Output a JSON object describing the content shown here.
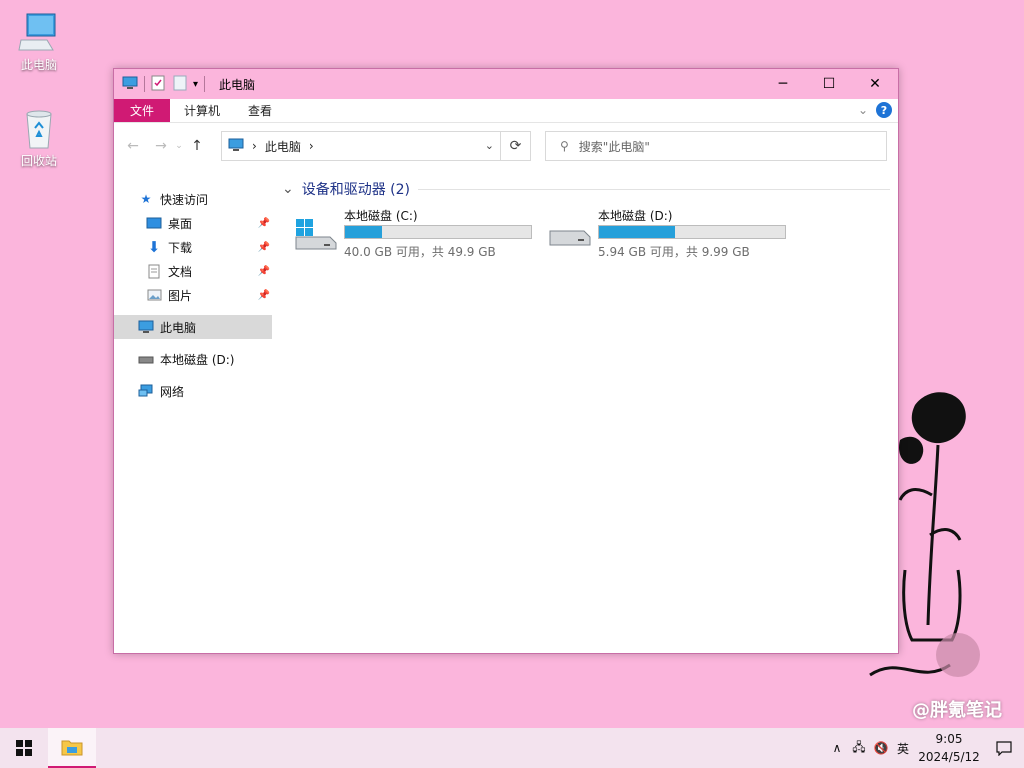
{
  "desktop": {
    "icons": [
      {
        "label": "此电脑",
        "icon": "computer-icon"
      },
      {
        "label": "回收站",
        "icon": "recycle-bin-icon"
      }
    ]
  },
  "window": {
    "title": "此电脑",
    "ribbon": {
      "tabs": [
        "文件",
        "计算机",
        "查看"
      ],
      "help": "?"
    },
    "nav": {
      "address_location": "此电脑",
      "search_placeholder": "搜索\"此电脑\""
    },
    "sidebar": {
      "quick_access": "快速访问",
      "quick_items": [
        {
          "label": "桌面",
          "icon": "desktop-icon"
        },
        {
          "label": "下载",
          "icon": "download-icon"
        },
        {
          "label": "文档",
          "icon": "documents-icon"
        },
        {
          "label": "图片",
          "icon": "pictures-icon"
        }
      ],
      "this_pc": "此电脑",
      "drive_d": "本地磁盘 (D:)",
      "network": "网络"
    },
    "content": {
      "group_title": "设备和驱动器 (2)",
      "drives": [
        {
          "name": "本地磁盘 (C:)",
          "info": "40.0 GB 可用，共 49.9 GB",
          "used_fraction": 0.2
        },
        {
          "name": "本地磁盘 (D:)",
          "info": "5.94 GB 可用，共 9.99 GB",
          "used_fraction": 0.41
        }
      ]
    }
  },
  "taskbar": {
    "ime": "英",
    "time": "9:05",
    "date": "2024/5/12"
  },
  "watermark": "@胖氪笔记",
  "colors": {
    "desktop_bg": "#fbb5dc",
    "accent": "#d01a74",
    "drive_bar": "#26a0da"
  }
}
